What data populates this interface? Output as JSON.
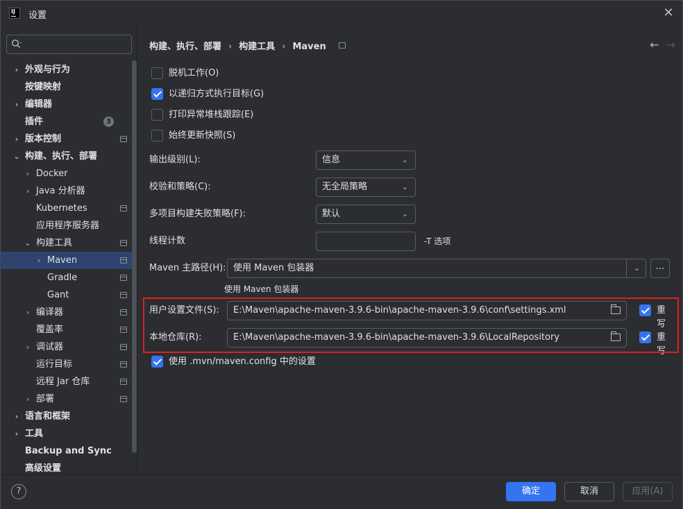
{
  "window": {
    "title": "设置",
    "app_icon_text": "IJ"
  },
  "sidebar": {
    "search_placeholder": "",
    "items": [
      {
        "label": "外观与行为",
        "chevron": "›",
        "bold": true
      },
      {
        "label": "按键映射",
        "bold": true
      },
      {
        "label": "编辑器",
        "chevron": "›",
        "bold": true
      },
      {
        "label": "插件",
        "bold": true,
        "badge": "3"
      },
      {
        "label": "版本控制",
        "chevron": "›",
        "bold": true
      },
      {
        "label": "构建、执行、部署",
        "chevron": "⌄",
        "bold": true
      },
      {
        "label": "Docker",
        "chevron": "›"
      },
      {
        "label": "Java 分析器",
        "chevron": "›"
      },
      {
        "label": "Kubernetes"
      },
      {
        "label": "应用程序服务器"
      },
      {
        "label": "构建工具",
        "chevron": "⌄"
      },
      {
        "label": "Maven",
        "chevron": "›",
        "selected": true
      },
      {
        "label": "Gradle"
      },
      {
        "label": "Gant"
      },
      {
        "label": "编译器",
        "chevron": "›"
      },
      {
        "label": "覆盖率"
      },
      {
        "label": "调试器",
        "chevron": "›"
      },
      {
        "label": "运行目标"
      },
      {
        "label": "远程 Jar 仓库"
      },
      {
        "label": "部署",
        "chevron": "›"
      },
      {
        "label": "语言和框架",
        "chevron": "›",
        "bold": true
      },
      {
        "label": "工具",
        "chevron": "›",
        "bold": true
      },
      {
        "label": "Backup and Sync",
        "bold": true
      },
      {
        "label": "高级设置",
        "bold": true
      }
    ]
  },
  "breadcrumb": {
    "part1": "构建、执行、部署",
    "sep": "›",
    "part2": "构建工具",
    "part3": "Maven"
  },
  "nav": {
    "back": "←",
    "forward": "→"
  },
  "options": {
    "offline": "脱机工作(O)",
    "recursive": "以递归方式执行目标(G)",
    "print_stack": "打印异常堆栈跟踪(E)",
    "always_update": "始终更新快照(S)"
  },
  "fields": {
    "output_level_label": "输出级别(L):",
    "output_level_value": "信息",
    "checksum_label": "校验和策略(C):",
    "checksum_value": "无全局策略",
    "multiproject_label": "多项目构建失败策略(F):",
    "multiproject_value": "默认",
    "threads_label": "线程计数",
    "threads_value": "",
    "threads_hint": "-T 选项",
    "maven_home_label": "Maven 主路径(H):",
    "maven_home_value": "使用 Maven 包装器",
    "maven_home_hint": "使用 Maven 包装器",
    "more_label": "...",
    "user_settings_label": "用户设置文件(S):",
    "user_settings_value": "E:\\Maven\\apache-maven-3.9.6-bin\\apache-maven-3.9.6\\conf\\settings.xml",
    "local_repo_label": "本地仓库(R):",
    "local_repo_value": "E:\\Maven\\apache-maven-3.9.6-bin\\apache-maven-3.9.6\\LocalRepository",
    "override_label": "重写",
    "mvn_config": "使用 .mvn/maven.config 中的设置"
  },
  "footer": {
    "help": "?",
    "ok": "确定",
    "cancel": "取消",
    "apply": "应用(A)"
  },
  "colors": {
    "accent": "#3574f0",
    "highlight_box": "#e02020",
    "selected_row": "#2e436e"
  }
}
